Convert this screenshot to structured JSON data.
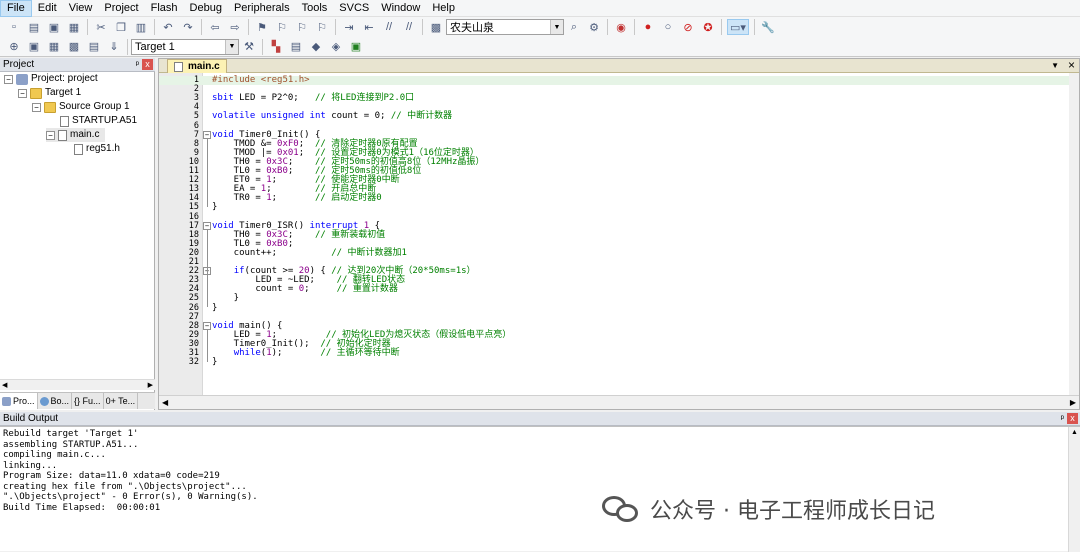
{
  "menubar": [
    "File",
    "Edit",
    "View",
    "Project",
    "Flash",
    "Debug",
    "Peripherals",
    "Tools",
    "SVCS",
    "Window",
    "Help"
  ],
  "toolbar": {
    "search_combo_value": "农夫山泉",
    "target_combo_value": "Target 1"
  },
  "project_pane": {
    "title": "Project",
    "pin": "ᵖ",
    "close": "x",
    "tree": [
      {
        "label": "Project: project",
        "expander": "−"
      },
      {
        "label": "Target 1",
        "expander": "−"
      },
      {
        "label": "Source Group 1",
        "expander": "−"
      },
      {
        "label": "STARTUP.A51"
      },
      {
        "label": "main.c",
        "expander": "−"
      },
      {
        "label": "reg51.h"
      }
    ],
    "tabs": [
      "Pro...",
      "Bo...",
      "{} Fu...",
      "0+ Te..."
    ]
  },
  "editor": {
    "tab_label": "main.c",
    "dropdown_glyph": "▼",
    "close_glyph": "×",
    "fold_glyph": "−",
    "lines": [
      {
        "n": "1",
        "html": "<span class=\"pp\">#include &lt;reg51.h&gt;</span>"
      },
      {
        "n": "2",
        "html": ""
      },
      {
        "n": "3",
        "html": "<span class=\"kw\">sbit</span> LED = P2^0;   <span class=\"cm\">// 将LED连接到P2.0口</span>"
      },
      {
        "n": "4",
        "html": ""
      },
      {
        "n": "5",
        "html": "<span class=\"kw\">volatile unsigned int</span> count = 0; <span class=\"cm\">// 中断计数器</span>"
      },
      {
        "n": "6",
        "html": ""
      },
      {
        "n": "7",
        "html": "<span class=\"kw\">void</span> Timer0_Init() {",
        "fold": true
      },
      {
        "n": "8",
        "html": "    TMOD &amp;= <span class=\"num\">0xF0</span>;  <span class=\"cm\">// 清除定时器0原有配置</span>"
      },
      {
        "n": "9",
        "html": "    TMOD |= <span class=\"num\">0x01</span>;  <span class=\"cm\">// 设置定时器0为模式1（16位定时器）</span>"
      },
      {
        "n": "10",
        "html": "    TH0 = <span class=\"num\">0x3C</span>;    <span class=\"cm\">// 定时50ms的初值高8位（12MHz晶振）</span>"
      },
      {
        "n": "11",
        "html": "    TL0 = <span class=\"num\">0xB0</span>;    <span class=\"cm\">// 定时50ms的初值低8位</span>"
      },
      {
        "n": "12",
        "html": "    ET0 = <span class=\"num\">1</span>;       <span class=\"cm\">// 使能定时器0中断</span>"
      },
      {
        "n": "13",
        "html": "    EA = <span class=\"num\">1</span>;        <span class=\"cm\">// 开启总中断</span>"
      },
      {
        "n": "14",
        "html": "    TR0 = <span class=\"num\">1</span>;       <span class=\"cm\">// 启动定时器0</span>"
      },
      {
        "n": "15",
        "html": "}"
      },
      {
        "n": "16",
        "html": ""
      },
      {
        "n": "17",
        "html": "<span class=\"kw\">void</span> Timer0_ISR() <span class=\"kw\">interrupt</span> <span class=\"num\">1</span> {",
        "fold": true
      },
      {
        "n": "18",
        "html": "    TH0 = <span class=\"num\">0x3C</span>;    <span class=\"cm\">// 重新装载初值</span>"
      },
      {
        "n": "19",
        "html": "    TL0 = <span class=\"num\">0xB0</span>;"
      },
      {
        "n": "20",
        "html": "    count++;          <span class=\"cm\">// 中断计数器加1</span>"
      },
      {
        "n": "21",
        "html": ""
      },
      {
        "n": "22",
        "html": "    <span class=\"kw\">if</span>(count &gt;= <span class=\"num\">20</span>) { <span class=\"cm\">// 达到20次中断（20*50ms=1s）</span>",
        "fold": true
      },
      {
        "n": "23",
        "html": "        LED = ~LED;    <span class=\"cm\">// 翻转LED状态</span>"
      },
      {
        "n": "24",
        "html": "        count = <span class=\"num\">0</span>;     <span class=\"cm\">// 重置计数器</span>"
      },
      {
        "n": "25",
        "html": "    }"
      },
      {
        "n": "26",
        "html": "}"
      },
      {
        "n": "27",
        "html": ""
      },
      {
        "n": "28",
        "html": "<span class=\"kw\">void</span> main() {",
        "fold": true
      },
      {
        "n": "29",
        "html": "    LED = <span class=\"num\">1</span>;         <span class=\"cm\">// 初始化LED为熄灭状态（假设低电平点亮）</span>"
      },
      {
        "n": "30",
        "html": "    Timer0_Init();  <span class=\"cm\">// 初始化定时器</span>"
      },
      {
        "n": "31",
        "html": "    <span class=\"kw\">while</span>(<span class=\"num\">1</span>);       <span class=\"cm\">// 主循环等待中断</span>"
      },
      {
        "n": "32",
        "html": "}"
      }
    ]
  },
  "build_output": {
    "title": "Build Output",
    "pin": "ᵖ",
    "close": "x",
    "lines": [
      "Rebuild target 'Target 1'",
      "assembling STARTUP.A51...",
      "compiling main.c...",
      "linking...",
      "Program Size: data=11.0 xdata=0 code=219",
      "creating hex file from \".\\Objects\\project\"...",
      "\".\\Objects\\project\" - 0 Error(s), 0 Warning(s).",
      "Build Time Elapsed:  00:00:01"
    ]
  },
  "watermark": {
    "text": "公众号 · 电子工程师成长日记"
  }
}
